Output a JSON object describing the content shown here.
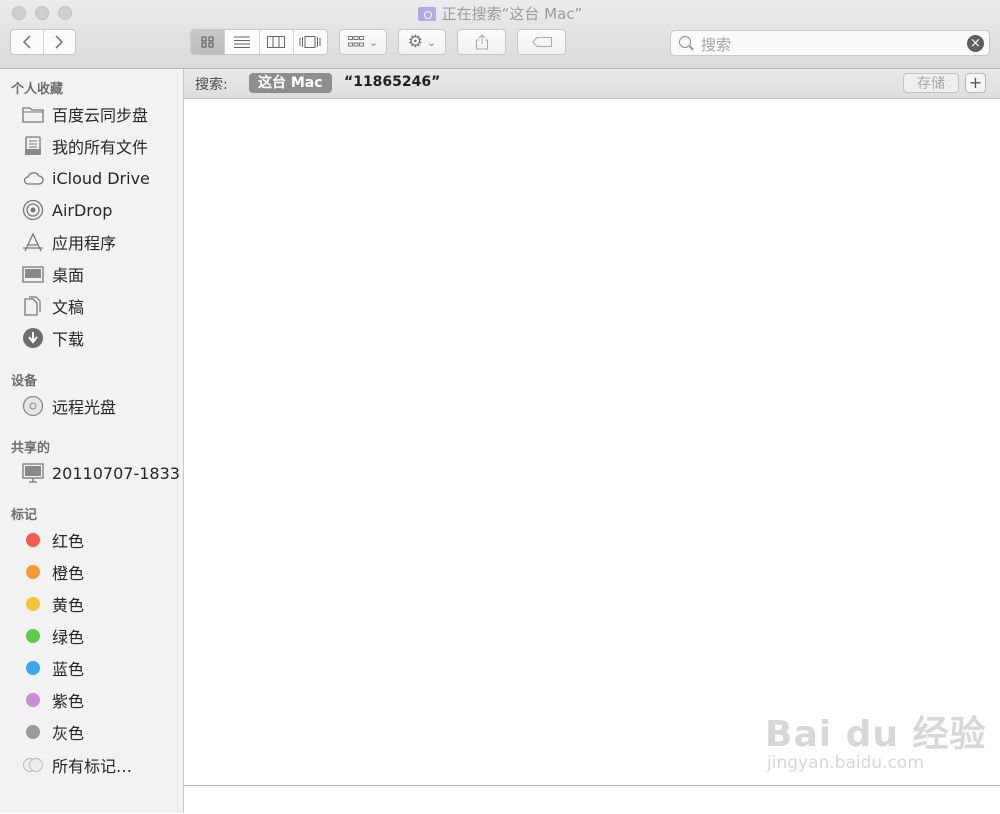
{
  "window": {
    "title": "正在搜索“这台 Mac”"
  },
  "toolbar": {
    "back_icon": "chevron-left-icon",
    "forward_icon": "chevron-right-icon",
    "views": [
      "icon-view",
      "list-view",
      "column-view",
      "coverflow-view"
    ],
    "active_view": "icon-view",
    "arrange_icon": "arrange-grid-icon",
    "action_icon": "gear-icon",
    "share_icon": "share-icon",
    "tag_icon": "tag-icon"
  },
  "search": {
    "placeholder": "搜索"
  },
  "sidebar": {
    "favorites_title": "个人收藏",
    "favorites": [
      {
        "label": "百度云同步盘",
        "icon": "folder-icon"
      },
      {
        "label": "我的所有文件",
        "icon": "all-files-icon"
      },
      {
        "label": "iCloud Drive",
        "icon": "cloud-icon"
      },
      {
        "label": "AirDrop",
        "icon": "airdrop-icon"
      },
      {
        "label": "应用程序",
        "icon": "applications-icon"
      },
      {
        "label": "桌面",
        "icon": "desktop-icon"
      },
      {
        "label": "文稿",
        "icon": "documents-icon"
      },
      {
        "label": "下载",
        "icon": "download-icon"
      }
    ],
    "devices_title": "设备",
    "devices": [
      {
        "label": "远程光盘",
        "icon": "disc-icon"
      }
    ],
    "shared_title": "共享的",
    "shared": [
      {
        "label": "20110707-1833",
        "icon": "computer-icon"
      }
    ],
    "tags_title": "标记",
    "tags": [
      {
        "label": "红色",
        "color": "#f05a4f"
      },
      {
        "label": "橙色",
        "color": "#f49b35"
      },
      {
        "label": "黄色",
        "color": "#f2c53a"
      },
      {
        "label": "绿色",
        "color": "#5dc84a"
      },
      {
        "label": "蓝色",
        "color": "#3aa8ee"
      },
      {
        "label": "紫色",
        "color": "#c98ad6"
      },
      {
        "label": "灰色",
        "color": "#9a9a9a"
      }
    ],
    "all_tags": "所有标记…"
  },
  "scopebar": {
    "label": "搜索:",
    "scope": "这台 Mac",
    "query": "“11865246”",
    "save": "存储",
    "add": "+"
  },
  "watermark": {
    "main": "Bai du 经验",
    "sub": "jingyan.baidu.com"
  }
}
